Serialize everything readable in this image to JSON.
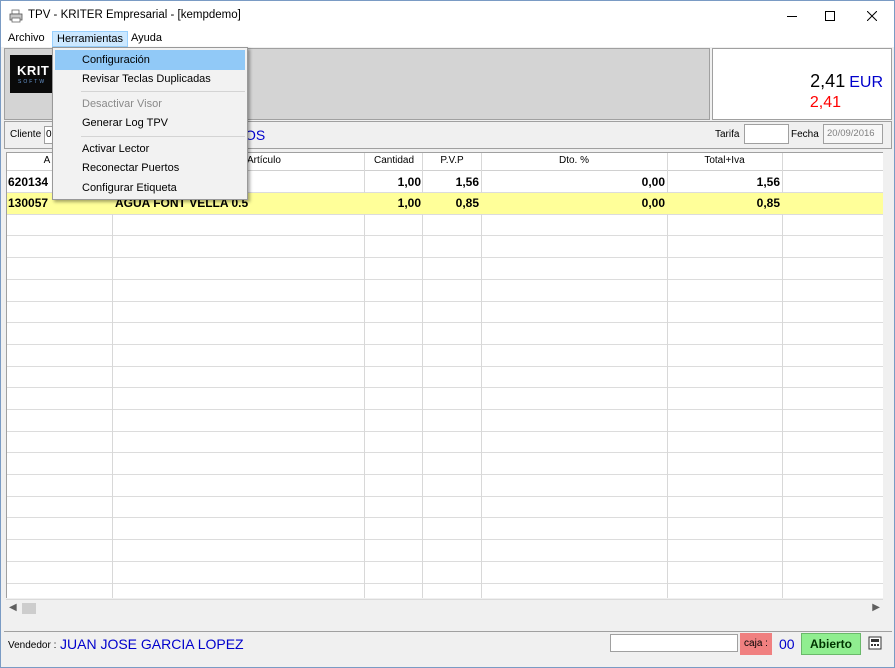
{
  "window": {
    "title": "TPV - KRITER Empresarial -  [kempdemo]",
    "icon": "printer-icon"
  },
  "menubar": {
    "items": [
      "Archivo",
      "Herramientas",
      "Ayuda"
    ],
    "active": "Herramientas"
  },
  "tools_menu": {
    "items": [
      {
        "label": "Configuración",
        "state": "highlighted"
      },
      {
        "label": "Revisar Teclas Duplicadas",
        "state": "enabled"
      },
      {
        "label": "Desactivar Visor",
        "state": "disabled"
      },
      {
        "label": "Generar Log TPV",
        "state": "enabled"
      },
      {
        "label": "Activar Lector",
        "state": "enabled"
      },
      {
        "label": "Reconectar Puertos",
        "state": "enabled"
      },
      {
        "label": "Configurar Etiqueta",
        "state": "enabled"
      }
    ]
  },
  "logo": {
    "text": "KRIT",
    "sub": "SOFTW"
  },
  "totals": {
    "main_amount": "2,41",
    "currency": "EUR",
    "secondary_amount": "2,41"
  },
  "client": {
    "label": "Cliente",
    "code": "0",
    "name": "OS",
    "tarifa_label": "Tarifa",
    "tarifa_value": "",
    "fecha_label": "Fecha",
    "fecha_value": "20/09/2016"
  },
  "grid": {
    "columns": [
      "A",
      "Artículo",
      "Cantidad",
      "P.V.P",
      "Dto. %",
      "Total+Iva"
    ],
    "rows": [
      {
        "code": "620134",
        "article": "",
        "qty": "1,00",
        "pvp": "1,56",
        "dto": "0,00",
        "total": "1,56",
        "selected": false
      },
      {
        "code": "130057",
        "article": "AGUA FONT VELLA 0.5",
        "qty": "1,00",
        "pvp": "0,85",
        "dto": "0,00",
        "total": "0,85",
        "selected": true
      }
    ]
  },
  "footer": {
    "vendor_label": "Vendedor :",
    "vendor_name": "JUAN JOSE GARCIA LOPEZ",
    "caja_label": "caja :",
    "caja_number": "00",
    "status": "Abierto"
  },
  "colors": {
    "accent_blue": "#0000cc",
    "total_red": "#ff0000",
    "selected_row": "#ffff99",
    "status_green": "#90ee90",
    "caja_red": "#f08080",
    "menu_highlight": "#91c9f7"
  }
}
